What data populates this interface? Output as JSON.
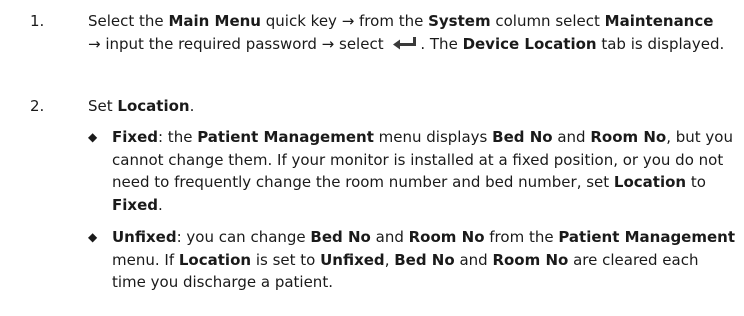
{
  "steps": [
    {
      "number": "1.",
      "parts": {
        "t1": "Select the ",
        "b1": "Main Menu",
        "t2": " quick key → from the ",
        "b2": "System",
        "t3": " column select ",
        "b3": "Maintenance",
        "t4": "→ input the required password → select ",
        "t5": ". The ",
        "b4": "Device Location",
        "t6": " tab is displayed."
      },
      "icon": "enter-return-icon"
    },
    {
      "number": "2.",
      "parts": {
        "t1": "Set ",
        "b1": "Location",
        "t2": "."
      }
    }
  ],
  "bullets": [
    {
      "marker": "◆",
      "parts": {
        "b1": "Fixed",
        "t1": ": the ",
        "b2": "Patient Management",
        "t2": " menu displays ",
        "b3": "Bed No",
        "t3": " and ",
        "b4": "Room No",
        "t4": ", but you cannot change them. If your monitor is installed at a fixed position, or you do not need to frequently change the room number and bed number, set ",
        "b5": "Location",
        "t5": " to ",
        "b6": "Fixed",
        "t6": "."
      }
    },
    {
      "marker": "◆",
      "parts": {
        "b1": "Unfixed",
        "t1": ": you can change ",
        "b2": "Bed No",
        "t2": " and ",
        "b3": "Room No",
        "t3": " from the ",
        "b4": "Patient Management",
        "t4": " menu. If ",
        "b5": "Location",
        "t5": " is set to ",
        "b6": "Unfixed",
        "t6": ", ",
        "b7": "Bed No",
        "t7": " and ",
        "b8": "Room No",
        "t8": " are cleared each time you discharge a patient."
      }
    }
  ],
  "colors": {
    "text": "#1a1a1a",
    "icon": "#3a3a3a"
  }
}
